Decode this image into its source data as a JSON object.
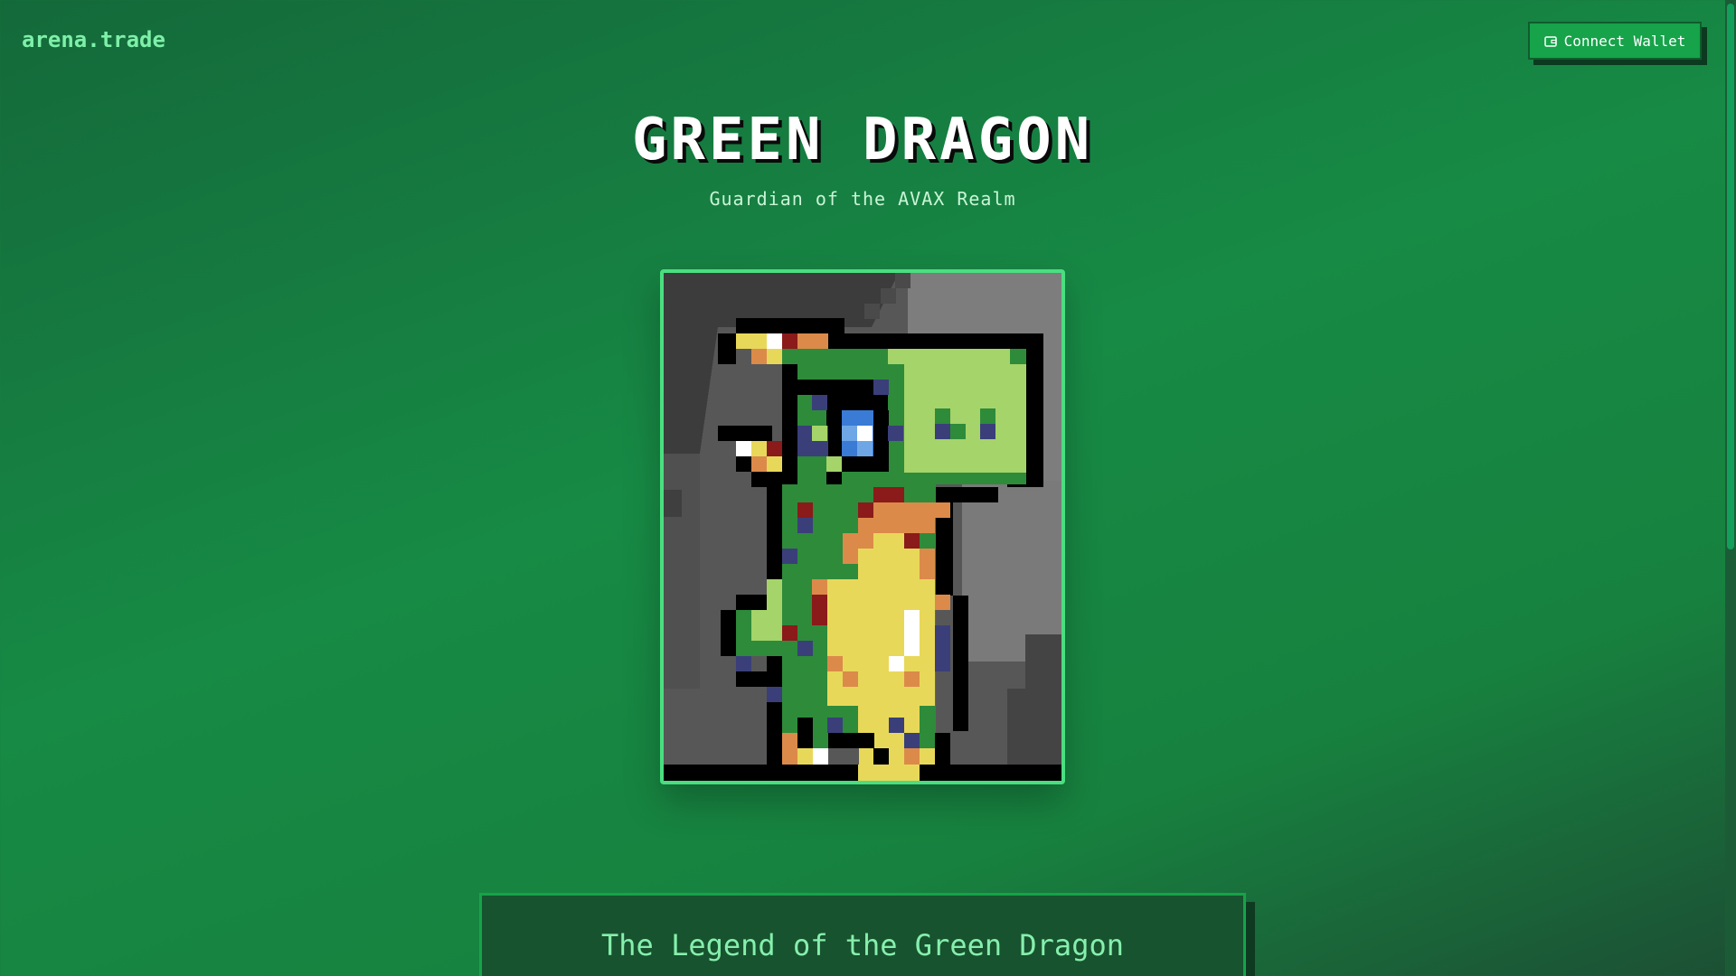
{
  "header": {
    "brand": "arena.trade",
    "connect_wallet_label": "Connect Wallet",
    "wallet_icon": "wallet-icon"
  },
  "hero": {
    "title": "GREEN DRAGON",
    "subtitle": "Guardian of the AVAX Realm"
  },
  "artwork": {
    "subject": "pixel-art green dragon holding a flame"
  },
  "legend": {
    "title": "The Legend of the Green Dragon"
  },
  "colors": {
    "accent": "#4ade80",
    "button": "#16a34a",
    "brand_text": "#7ef0a8",
    "panel_bg": "#17532f",
    "dragon_green": "#2e8b3a",
    "dragon_light": "#a5d46a",
    "belly_yellow": "#e8d85a",
    "orange": "#dc8a4a",
    "eye_blue": "#3a7bd5"
  }
}
